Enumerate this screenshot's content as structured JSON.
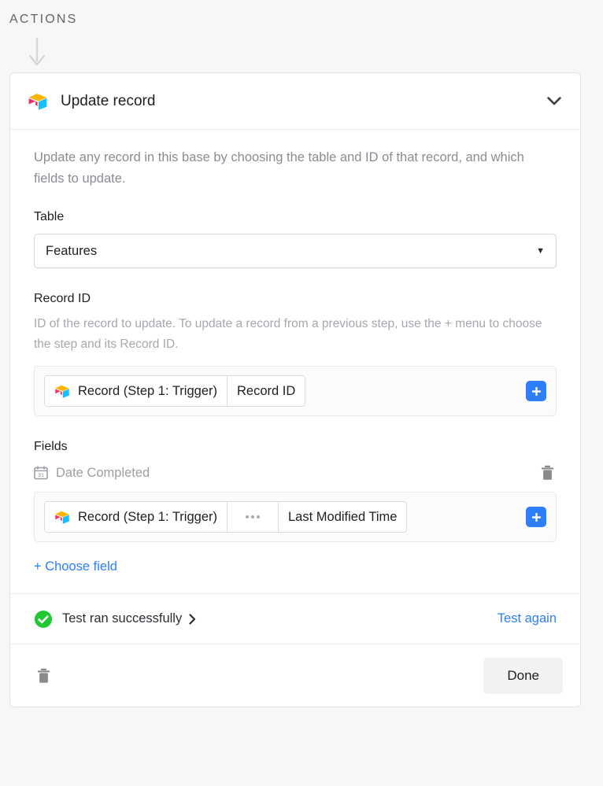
{
  "section": {
    "heading": "ACTIONS",
    "flow_arrow_icon": "arrow-down-icon"
  },
  "card": {
    "header": {
      "icon": "airtable-logo-icon",
      "title": "Update record",
      "collapse_icon": "chevron-down-icon"
    },
    "description": "Update any record in this base by choosing the table and ID of that record, and which fields to update.",
    "table": {
      "label": "Table",
      "selected": "Features",
      "caret_icon": "chevron-down-icon"
    },
    "record_id": {
      "label": "Record ID",
      "helper": "ID of the record to update. To update a record from a previous step, use the + menu to choose the step and its Record ID.",
      "token": {
        "source_icon": "airtable-logo-icon",
        "source": "Record (Step 1: Trigger)",
        "property": "Record ID"
      },
      "add_icon": "plus-icon"
    },
    "fields": {
      "label": "Fields",
      "items": [
        {
          "type_icon": "calendar-icon",
          "name": "Date Completed",
          "delete_icon": "trash-icon",
          "token": {
            "source_icon": "airtable-logo-icon",
            "source": "Record (Step 1: Trigger)",
            "separator_icon": "ellipsis-icon",
            "property": "Last Modified Time"
          },
          "add_icon": "plus-icon"
        }
      ],
      "choose_field_label": "+ Choose field"
    },
    "test": {
      "status_icon": "check-circle-icon",
      "status_text": "Test ran successfully",
      "expand_icon": "chevron-right-icon",
      "test_again_label": "Test again"
    },
    "footer": {
      "delete_icon": "trash-icon",
      "done_label": "Done"
    }
  },
  "colors": {
    "accent_blue": "#2d7ff9",
    "success_green": "#20c933",
    "page_bg": "#f7f7f7",
    "card_bg": "#ffffff",
    "muted_text": "#898d93"
  }
}
